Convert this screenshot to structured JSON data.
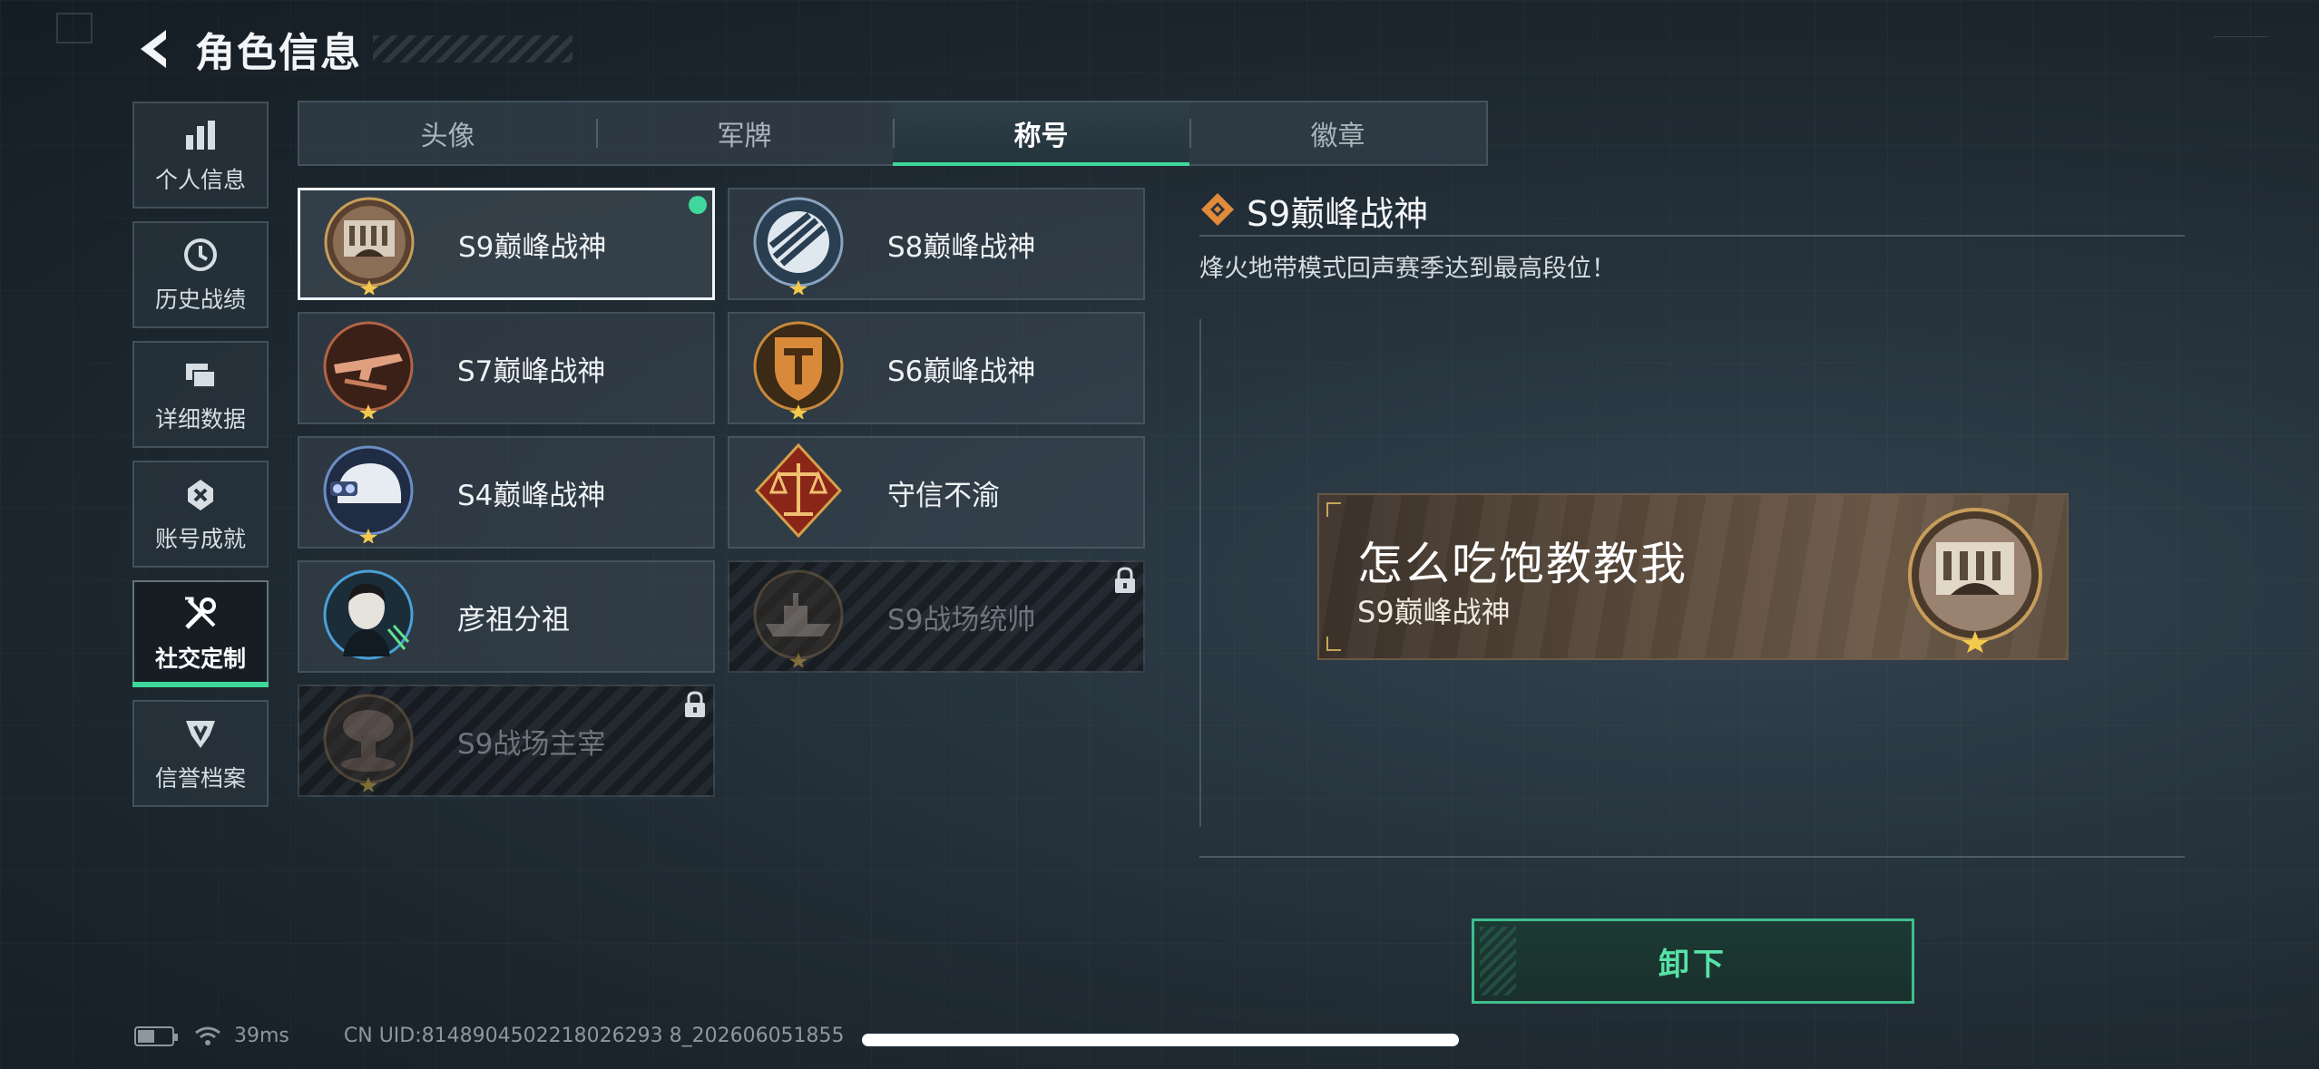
{
  "header": {
    "title": "角色信息"
  },
  "sidebar": {
    "items": [
      {
        "label": "个人信息",
        "icon": "bar-chart-icon"
      },
      {
        "label": "历史战绩",
        "icon": "clock-icon"
      },
      {
        "label": "详细数据",
        "icon": "folders-icon"
      },
      {
        "label": "账号成就",
        "icon": "achievement-icon"
      },
      {
        "label": "社交定制",
        "icon": "tools-icon",
        "active": true
      },
      {
        "label": "信誉档案",
        "icon": "emblem-icon"
      }
    ]
  },
  "tabs": [
    {
      "label": "头像"
    },
    {
      "label": "军牌"
    },
    {
      "label": "称号",
      "active": true
    },
    {
      "label": "徽章"
    }
  ],
  "titles": [
    {
      "label": "S9巅峰战神",
      "emblem": "fortress-emblem-icon",
      "equipped": true,
      "locked": false
    },
    {
      "label": "S8巅峰战神",
      "emblem": "globe-emblem-icon",
      "locked": false
    },
    {
      "label": "S7巅峰战神",
      "emblem": "rifle-emblem-icon",
      "locked": false
    },
    {
      "label": "S6巅峰战神",
      "emblem": "shield-emblem-icon",
      "locked": false
    },
    {
      "label": "S4巅峰战神",
      "emblem": "helmet-emblem-icon",
      "locked": false
    },
    {
      "label": "守信不渝",
      "emblem": "scales-emblem-icon",
      "locked": false
    },
    {
      "label": "彦祖分祖",
      "emblem": "portrait-emblem-icon",
      "locked": false
    },
    {
      "label": "S9战场统帅",
      "emblem": "warship-emblem-icon",
      "locked": true
    },
    {
      "label": "S9战场主宰",
      "emblem": "mushroom-cloud-emblem-icon",
      "locked": true
    }
  ],
  "detail": {
    "title": "S9巅峰战神",
    "description": "烽火地带模式回声赛季达到最高段位！"
  },
  "nameplate": {
    "player_name": "怎么吃饱教教我",
    "title": "S9巅峰战神"
  },
  "unequip_label": "卸下",
  "status": {
    "ping": "39ms",
    "uid": "CN UID:8148904502218026293 8_202606051855",
    "battery_level": 0.45
  },
  "colors": {
    "accent": "#3fd79b",
    "background": "#1f2a33",
    "nameplate": "#5a4a3b"
  }
}
